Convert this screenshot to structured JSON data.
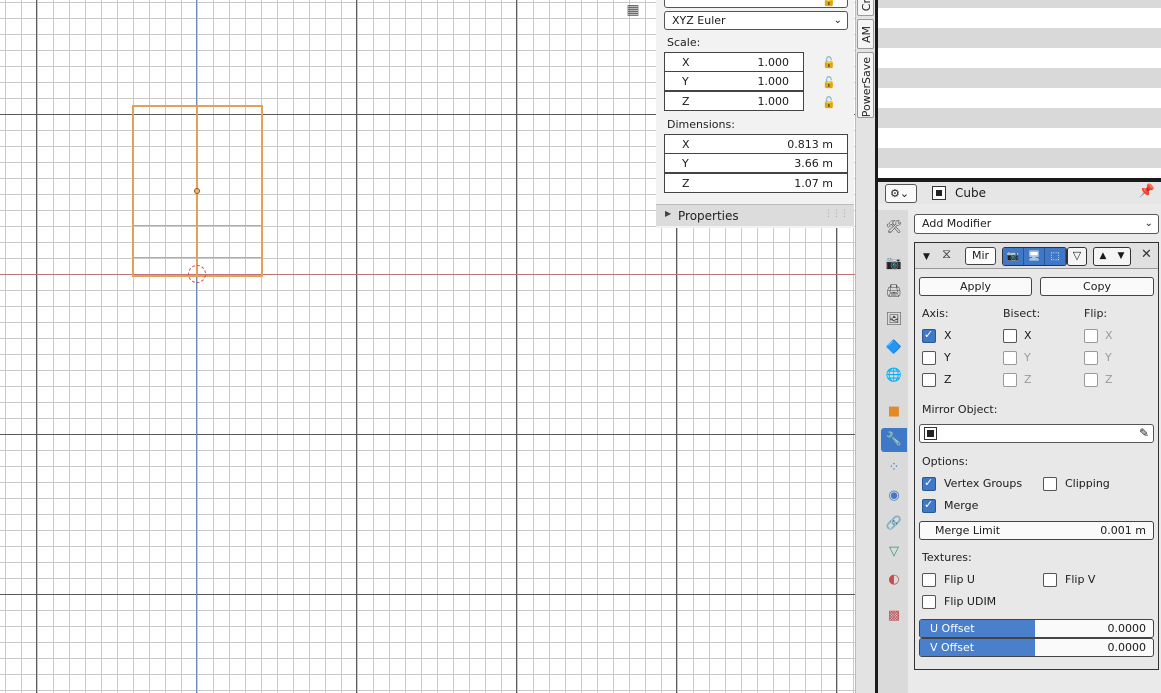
{
  "npanel": {
    "rotation_mode": "XYZ Euler",
    "scale_label": "Scale:",
    "scale": [
      {
        "axis": "X",
        "value": "1.000"
      },
      {
        "axis": "Y",
        "value": "1.000"
      },
      {
        "axis": "Z",
        "value": "1.000"
      }
    ],
    "dimensions_label": "Dimensions:",
    "dimensions": [
      {
        "axis": "X",
        "value": "0.813 m"
      },
      {
        "axis": "Y",
        "value": "3.66 m"
      },
      {
        "axis": "Z",
        "value": "1.07 m"
      }
    ],
    "properties_label": "Properties"
  },
  "vertical_tabs": [
    "Cr",
    "AM",
    "PowerSave"
  ],
  "properties_editor": {
    "object_name": "Cube",
    "add_modifier": "Add Modifier",
    "modifier": {
      "name": "Mir",
      "apply": "Apply",
      "copy": "Copy",
      "axis_label": "Axis:",
      "bisect_label": "Bisect:",
      "flip_label": "Flip:",
      "axis_x": "X",
      "axis_y": "Y",
      "axis_z": "Z",
      "mirror_object_label": "Mirror Object:",
      "options_label": "Options:",
      "vertex_groups": "Vertex Groups",
      "clipping": "Clipping",
      "merge": "Merge",
      "merge_limit_label": "Merge Limit",
      "merge_limit_value": "0.001 m",
      "textures_label": "Textures:",
      "flip_u": "Flip U",
      "flip_v": "Flip V",
      "flip_udim": "Flip UDIM",
      "u_offset_label": "U Offset",
      "u_offset_value": "0.0000",
      "v_offset_label": "V Offset",
      "v_offset_value": "0.0000",
      "checked": {
        "axis_x": true,
        "axis_y": false,
        "axis_z": false,
        "bisect_x": false,
        "bisect_y": false,
        "bisect_z": false,
        "flip_x": false,
        "flip_y": false,
        "flip_z": false,
        "vertex_groups": true,
        "clipping": false,
        "merge": true,
        "flip_u": false,
        "flip_v": false,
        "flip_udim": false
      }
    }
  },
  "colors": {
    "accent": "#3f78c6",
    "selection": "#e4a05a",
    "x_axis": "#c07474",
    "y_axis": "#6d8db5"
  },
  "icons": [
    "grid-view-icon",
    "lock-icon",
    "editor-type-icon",
    "cube-icon",
    "pin-icon",
    "tool-icon",
    "render-icon",
    "output-icon",
    "view-layer-icon",
    "scene-icon",
    "world-icon",
    "object-icon",
    "modifier-wrench-icon",
    "particles-icon",
    "physics-icon",
    "constraints-icon",
    "data-icon",
    "material-icon",
    "texture-icon",
    "mirror-modifier-icon",
    "camera-icon",
    "monitor-icon",
    "editmode-icon",
    "cage-icon",
    "move-up-icon",
    "move-down-icon",
    "close-icon",
    "eyedropper-icon"
  ]
}
